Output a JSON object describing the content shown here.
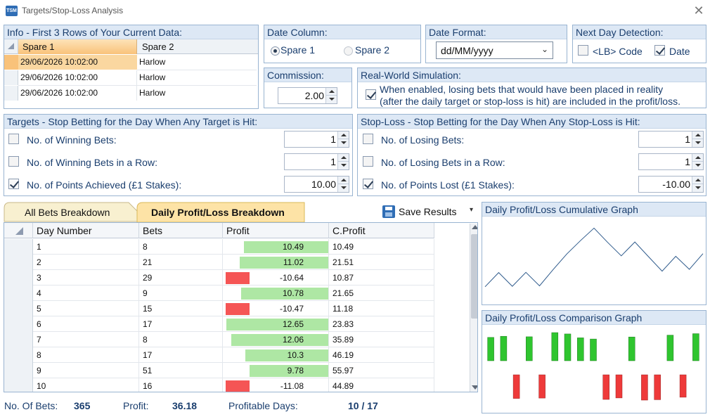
{
  "window": {
    "title": "Targets/Stop-Loss Analysis",
    "icon_text": "TSM"
  },
  "info": {
    "header": "Info - First 3 Rows of Your Current Data:",
    "columns": [
      "Spare 1",
      "Spare 2"
    ],
    "rows": [
      [
        "29/06/2026 10:02:00",
        "Harlow"
      ],
      [
        "29/06/2026 10:02:00",
        "Harlow"
      ],
      [
        "29/06/2026 10:02:00",
        "Harlow"
      ]
    ]
  },
  "date_column": {
    "header": "Date Column:",
    "option1": "Spare 1",
    "option2": "Spare 2"
  },
  "date_format": {
    "header": "Date Format:",
    "value": "dd/MM/yyyy"
  },
  "next_day": {
    "header": "Next Day Detection:",
    "lb_code": "<LB> Code",
    "date": "Date"
  },
  "commission": {
    "header": "Commission:",
    "value": "2.00"
  },
  "real_world": {
    "header": "Real-World Simulation:",
    "line1": "When enabled, losing bets that would have been placed in reality",
    "line2": "(after the daily target or stop-loss is hit) are included in the profit/loss."
  },
  "targets": {
    "header": "Targets - Stop Betting for the Day When Any Target is Hit:",
    "items": [
      {
        "label": "No. of Winning Bets:",
        "value": "1"
      },
      {
        "label": "No. of Winning Bets in a Row:",
        "value": "1"
      },
      {
        "label": "No. of Points Achieved (£1 Stakes):",
        "value": "10.00"
      }
    ]
  },
  "stoploss": {
    "header": "Stop-Loss - Stop Betting for the Day When Any Stop-Loss is Hit:",
    "items": [
      {
        "label": "No. of Losing Bets:",
        "value": "1"
      },
      {
        "label": "No. of Losing Bets in a Row:",
        "value": "1"
      },
      {
        "label": "No. of Points Lost (£1 Stakes):",
        "value": "-10.00"
      }
    ]
  },
  "tabs": {
    "all_bets": "All Bets Breakdown",
    "daily": "Daily Profit/Loss Breakdown",
    "save": "Save Results"
  },
  "grid": {
    "columns": [
      "Day Number",
      "Bets",
      "Profit",
      "C.Profit"
    ],
    "rows": [
      {
        "day": "1",
        "bets": "8",
        "profit": "10.49",
        "cprofit": "10.49"
      },
      {
        "day": "2",
        "bets": "21",
        "profit": "11.02",
        "cprofit": "21.51"
      },
      {
        "day": "3",
        "bets": "29",
        "profit": "-10.64",
        "cprofit": "10.87"
      },
      {
        "day": "4",
        "bets": "9",
        "profit": "10.78",
        "cprofit": "21.65"
      },
      {
        "day": "5",
        "bets": "15",
        "profit": "-10.47",
        "cprofit": "11.18"
      },
      {
        "day": "6",
        "bets": "17",
        "profit": "12.65",
        "cprofit": "23.83"
      },
      {
        "day": "7",
        "bets": "8",
        "profit": "12.06",
        "cprofit": "35.89"
      },
      {
        "day": "8",
        "bets": "17",
        "profit": "10.3",
        "cprofit": "46.19"
      },
      {
        "day": "9",
        "bets": "51",
        "profit": "9.78",
        "cprofit": "55.97"
      },
      {
        "day": "10",
        "bets": "16",
        "profit": "-11.08",
        "cprofit": "44.89"
      }
    ]
  },
  "charts": {
    "cumulative_title": "Daily Profit/Loss Cumulative Graph",
    "comparison_title": "Daily Profit/Loss Comparison Graph"
  },
  "chart_data": [
    {
      "type": "line",
      "x": [
        1,
        2,
        3,
        4,
        5,
        6,
        7,
        8,
        9,
        10,
        11,
        12,
        13,
        14,
        15,
        16,
        17
      ],
      "values": [
        10.49,
        21.51,
        10.87,
        21.65,
        11.18,
        23.83,
        35.89,
        46.19,
        55.97,
        44.89,
        34.5,
        45.2,
        33.8,
        22.6,
        34.1,
        24.0,
        36.18
      ]
    },
    {
      "type": "bar",
      "x": [
        1,
        2,
        3,
        4,
        5,
        6,
        7,
        8,
        9,
        10,
        11,
        12,
        13,
        14,
        15,
        16,
        17
      ],
      "values": [
        10.49,
        11.02,
        -10.64,
        10.78,
        -10.47,
        12.65,
        12.06,
        10.3,
        9.78,
        -11.08,
        -10.39,
        10.7,
        -11.4,
        -11.2,
        11.5,
        -10.1,
        12.18
      ]
    }
  ],
  "status": {
    "bets_label": "No. Of Bets:",
    "bets_value": "365",
    "profit_label": "Profit:",
    "profit_value": "36.18",
    "days_label": "Profitable Days:",
    "days_value": "10 / 17"
  },
  "colors": {
    "positive": "#aee7a4",
    "negative": "#f55555",
    "accent": "#1a3e6e",
    "selected_row": "#f9c27a"
  }
}
